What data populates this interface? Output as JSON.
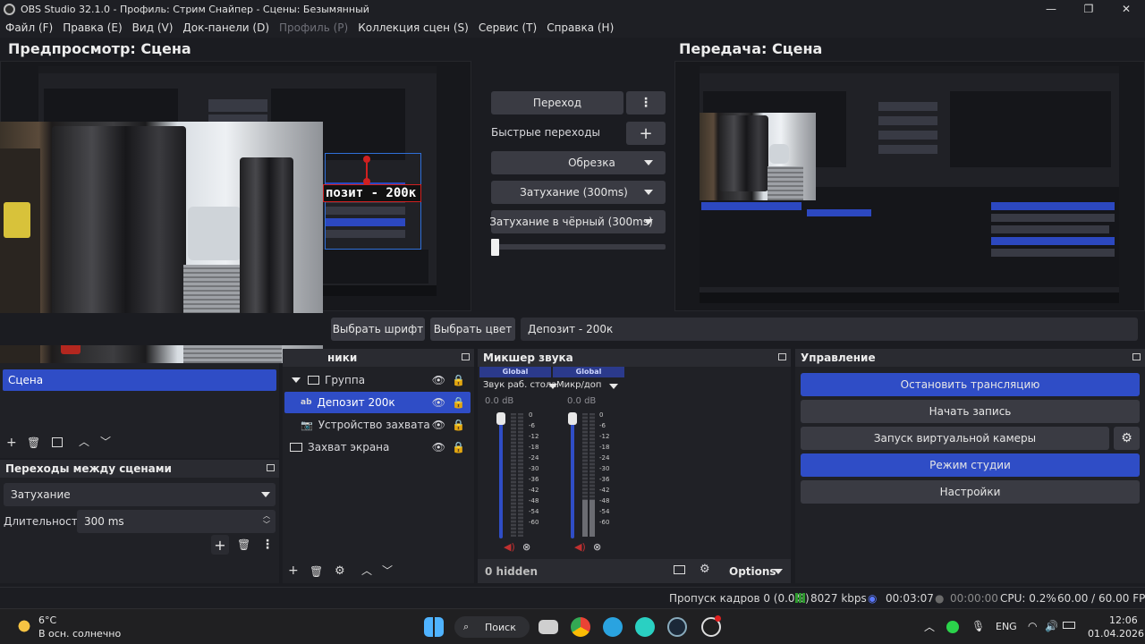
{
  "window": {
    "title": "OBS Studio 32.1.0 - Профиль: Стрим Снайпер - Сцены: Безымянный",
    "min": "—",
    "max": "❐",
    "close": "✕"
  },
  "menu": [
    {
      "label": "Файл (F)",
      "enabled": true
    },
    {
      "label": "Правка (E)",
      "enabled": true
    },
    {
      "label": "Вид (V)",
      "enabled": true
    },
    {
      "label": "Док-панели (D)",
      "enabled": true
    },
    {
      "label": "Профиль (P)",
      "enabled": false
    },
    {
      "label": "Коллекция сцен (S)",
      "enabled": true
    },
    {
      "label": "Сервис (T)",
      "enabled": true
    },
    {
      "label": "Справка (H)",
      "enabled": true
    }
  ],
  "preview": {
    "title": "Предпросмотр: Сцена",
    "overlay_text": "позит - 200к"
  },
  "program": {
    "title": "Передача: Сцена"
  },
  "transition_panel": {
    "transition_button": "Переход",
    "quick_transitions": "Быстрые переходы",
    "items": [
      "Обрезка",
      "Затухание (300ms)",
      "Затухание в чёрный (300ms)"
    ],
    "t_bar": 0.0
  },
  "text_toolbar": {
    "font_button": "Выбрать шрифт",
    "color_button": "Выбрать цвет",
    "text_value": "Депозит - 200к"
  },
  "scenes": {
    "items": [
      {
        "label": "Сцена",
        "selected": true
      }
    ]
  },
  "transitions_dock": {
    "title": "Переходы между сценами",
    "current": "Затухание",
    "duration_label": "Длительность",
    "duration_value": "300 ms"
  },
  "sources": {
    "title": "Источники",
    "title_visible": "ники",
    "items": [
      {
        "label": "Группа",
        "icon": "folder-icon",
        "level": 0,
        "selected": false
      },
      {
        "label": "Депозит 200к",
        "icon": "text-icon",
        "level": 1,
        "selected": true
      },
      {
        "label": "Устройство захвата вид",
        "icon": "camera-icon",
        "level": 1,
        "selected": false
      },
      {
        "label": "Захват экрана",
        "icon": "monitor-icon",
        "level": 0,
        "selected": false
      }
    ]
  },
  "mixer": {
    "title": "Микшер звука",
    "channels": [
      {
        "global": "Global",
        "name": "Звук раб. стола",
        "db": "0.0 dB",
        "volume": 1.0,
        "level": 0.0
      },
      {
        "global": "Global",
        "name": "Микр/доп",
        "db": "0.0 dB",
        "volume": 1.0,
        "level": 0.2
      }
    ],
    "scale": [
      "0",
      "-6",
      "-12",
      "-18",
      "-24",
      "-30",
      "-36",
      "-42",
      "-48",
      "-54",
      "-60"
    ],
    "hidden": "0 hidden",
    "options": "Options"
  },
  "controls": {
    "title": "Управление",
    "buttons": [
      {
        "label": "Остановить трансляцию",
        "active": true
      },
      {
        "label": "Начать запись",
        "active": false
      },
      {
        "label": "Запуск виртуальной камеры",
        "active": false
      },
      {
        "label": "Режим студии",
        "active": true
      },
      {
        "label": "Настройки",
        "active": false
      }
    ]
  },
  "status": {
    "dropped": "Пропуск кадров 0 (0.0%)",
    "bitrate": "8027 kbps",
    "stream_time": "00:03:07",
    "record_time": "00:00:00",
    "cpu": "CPU: 0.2%",
    "fps": "60.00 / 60.00 FPS"
  },
  "taskbar": {
    "weather_temp": "6°C",
    "weather_desc": "В осн. солнечно",
    "search": "Поиск",
    "lang": "ENG",
    "time": "12:06",
    "date": "01.04.2026"
  },
  "colors": {
    "accent": "#2f4dc6",
    "background": "#1b1c21",
    "panel": "#202126",
    "button": "#3a3b43"
  }
}
